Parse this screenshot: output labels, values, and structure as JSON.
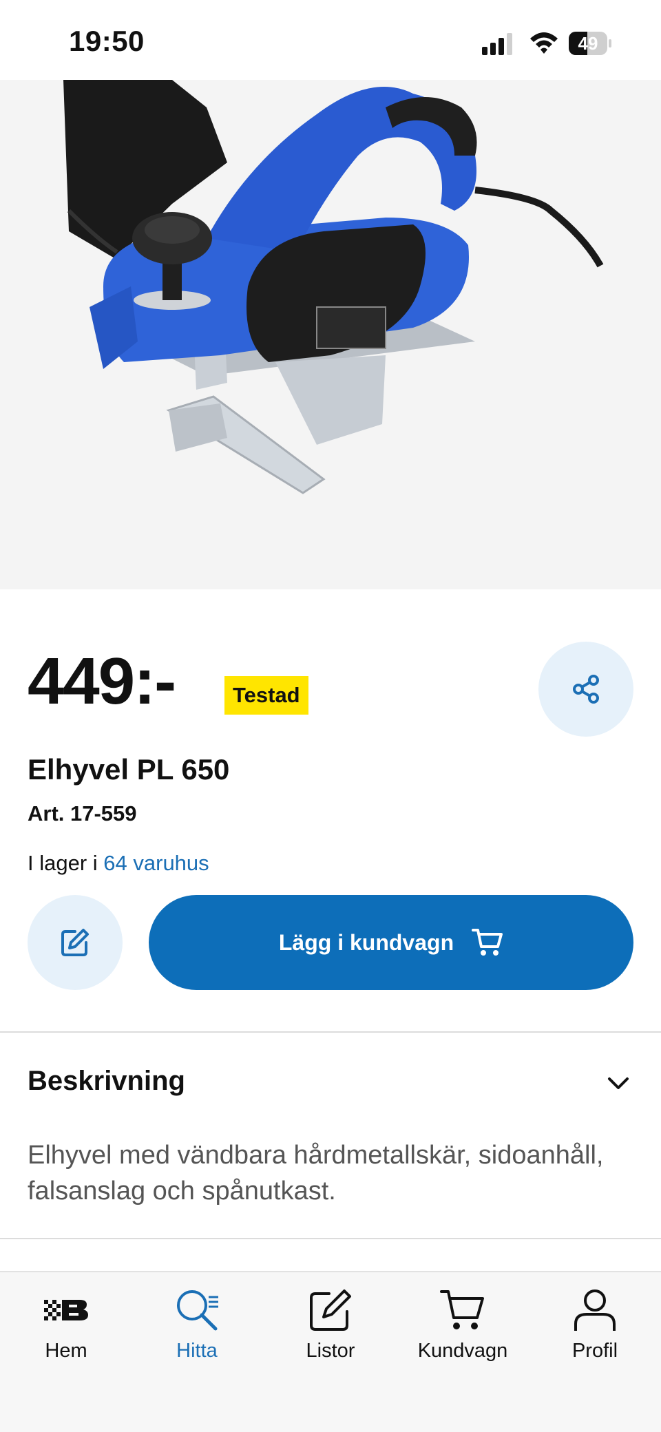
{
  "status_bar": {
    "time": "19:50",
    "battery": "49",
    "battery_level": 0.49
  },
  "product": {
    "price": "449:-",
    "badge": "Testad",
    "title": "Elhyvel PL 650",
    "article": "Art. 17-559",
    "stock_prefix": "I lager i ",
    "stock_link": "64 varuhus"
  },
  "actions": {
    "add_to_cart_label": "Lägg i kundvagn"
  },
  "description": {
    "header": "Beskrivning",
    "text": "Elhyvel med vändbara hårdmetallskär, sidoanhåll, falsanslag och spånutkast."
  },
  "nav": {
    "items": [
      {
        "label": "Hem",
        "icon": "bauhaus-logo-icon"
      },
      {
        "label": "Hitta",
        "icon": "search-icon"
      },
      {
        "label": "Listor",
        "icon": "edit-icon"
      },
      {
        "label": "Kundvagn",
        "icon": "cart-icon"
      },
      {
        "label": "Profil",
        "icon": "user-icon"
      }
    ],
    "active": "Hitta"
  },
  "colors": {
    "accent": "#0d6eb9",
    "link": "#1b6fb5",
    "badge": "#ffe500",
    "light_circle": "#e6f1fa"
  }
}
